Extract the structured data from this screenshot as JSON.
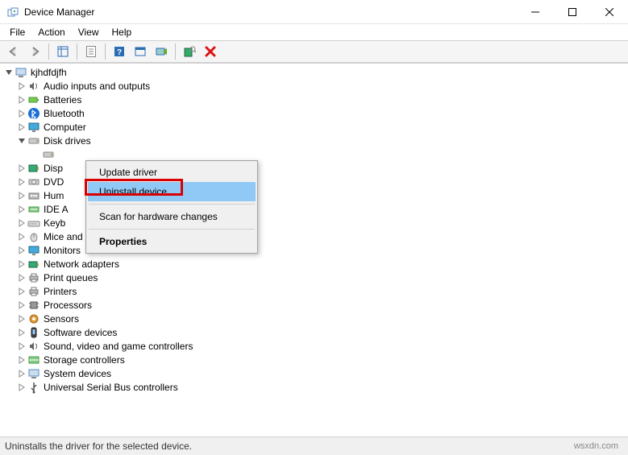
{
  "window": {
    "title": "Device Manager"
  },
  "menubar": {
    "file": "File",
    "action": "Action",
    "view": "View",
    "help": "Help"
  },
  "tree": {
    "root": "kjhdfdjfh",
    "nodes": {
      "audio": "Audio inputs and outputs",
      "batteries": "Batteries",
      "bluetooth": "Bluetooth",
      "computer": "Computer",
      "diskdrives": "Disk drives",
      "disk_child": "",
      "display": "Disp",
      "dvd": "DVD",
      "hid": "Hum",
      "ide": "IDE A",
      "keyboards": "Keyb",
      "mice": "Mice and other pointing devices",
      "monitors": "Monitors",
      "network": "Network adapters",
      "printqueues": "Print queues",
      "printers": "Printers",
      "processors": "Processors",
      "sensors": "Sensors",
      "software": "Software devices",
      "sound": "Sound, video and game controllers",
      "storage": "Storage controllers",
      "system": "System devices",
      "usb": "Universal Serial Bus controllers"
    }
  },
  "context_menu": {
    "update": "Update driver",
    "uninstall": "Uninstall device",
    "scan": "Scan for hardware changes",
    "properties": "Properties"
  },
  "statusbar": {
    "text": "Uninstalls the driver for the selected device."
  },
  "watermark": "wsxdn.com"
}
